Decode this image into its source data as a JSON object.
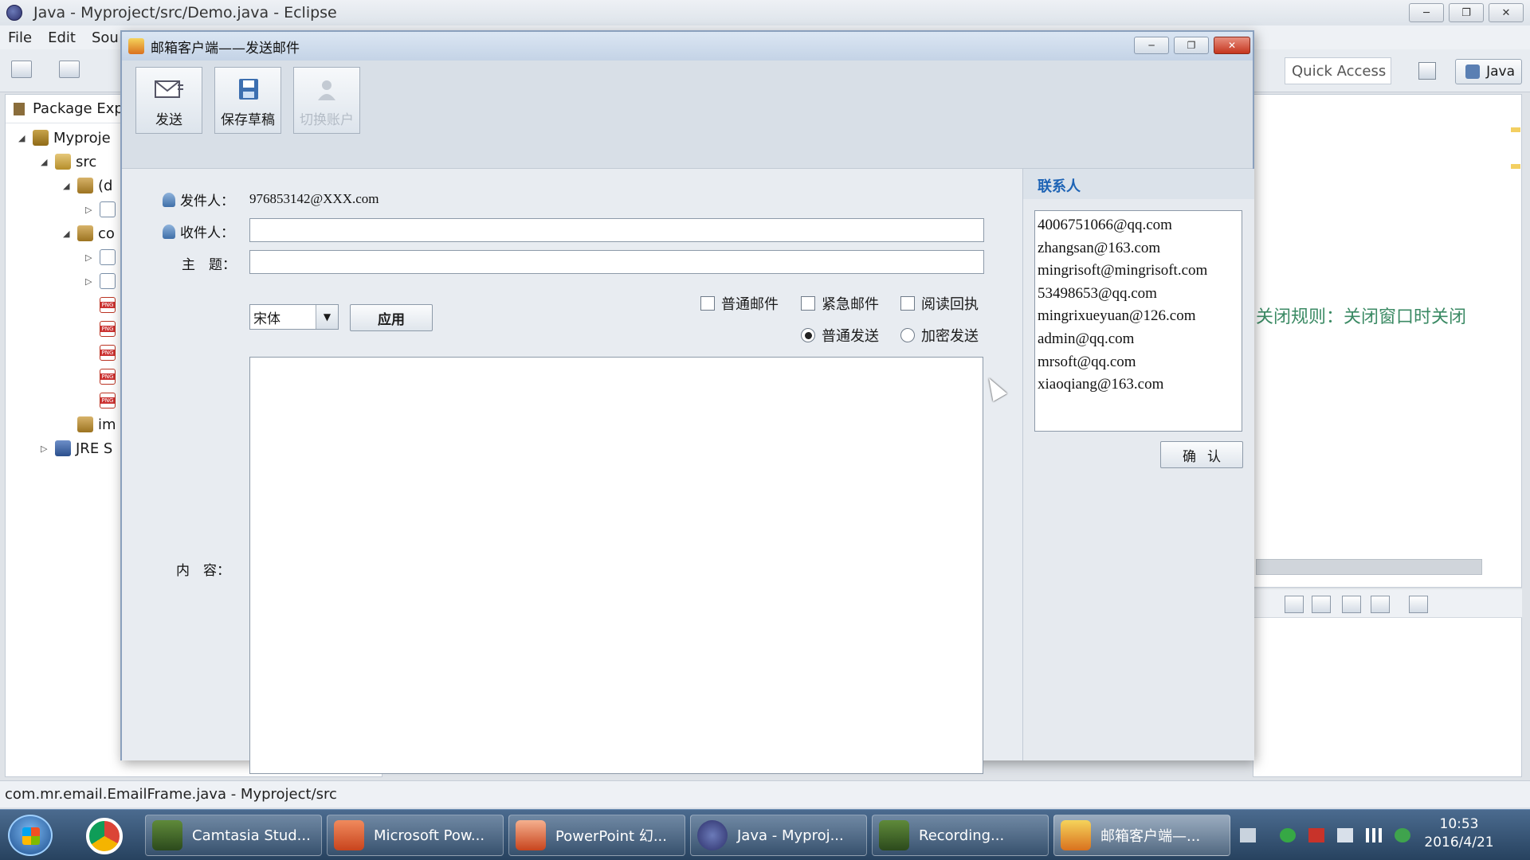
{
  "eclipse": {
    "title": "Java - Myproject/src/Demo.java - Eclipse",
    "menu": [
      "File",
      "Edit",
      "Sou"
    ],
    "quick_access": "Quick Access",
    "perspective": "Java",
    "package_explorer": {
      "title": "Package Exp",
      "tree": [
        "Myproje",
        "src",
        "(d",
        "co",
        "im",
        "JRE S"
      ]
    },
    "editor_comment": "关闭规则：关闭窗口时关闭",
    "status": "com.mr.email.EmailFrame.java - Myproject/src"
  },
  "mail": {
    "title": "邮箱客户端——发送邮件",
    "toolbar": {
      "send": "发送",
      "save_draft": "保存草稿",
      "switch_account": "切换账户"
    },
    "form": {
      "sender_label": "发件人：",
      "sender_value": "976853142@XXX.com",
      "recipient_label": "收件人：",
      "recipient_value": "",
      "subject_label": "主　题：",
      "subject_value": "",
      "font_value": "宋体",
      "apply_label": "应用",
      "content_label": "内　容：",
      "checkbox_normal": "普通邮件",
      "checkbox_urgent": "紧急邮件",
      "checkbox_receipt": "阅读回执",
      "radio_normal_send": "普通发送",
      "radio_encrypted_send": "加密发送"
    },
    "contacts": {
      "title": "联系人",
      "items": [
        "4006751066@qq.com",
        "zhangsan@163.com",
        "mingrisoft@mingrisoft.com",
        "53498653@qq.com",
        "mingrixueyuan@126.com",
        "admin@qq.com",
        "mrsoft@qq.com",
        "xiaoqiang@163.com"
      ],
      "confirm_label": "确认"
    }
  },
  "taskbar": {
    "items": [
      "Camtasia Stud...",
      "Microsoft Pow...",
      "PowerPoint 幻...",
      "Java - Myproj...",
      "Recording...",
      "邮箱客户端—..."
    ],
    "time": "10:53",
    "date": "2016/4/21"
  }
}
